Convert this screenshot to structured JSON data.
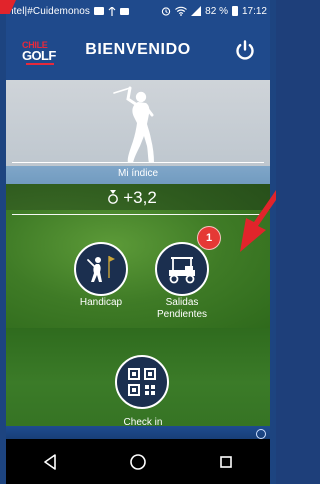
{
  "status_bar": {
    "carrier": "ntel|#Cuidemonos",
    "battery": "82 %",
    "time": "17:12",
    "icons": [
      "messages-icon",
      "network-icon",
      "sim-icon",
      "alarm-icon",
      "wifi-icon",
      "signal-icon",
      "battery-icon"
    ]
  },
  "header": {
    "logo_line1": "CHILE",
    "logo_line2": "GOLF",
    "title": "BIENVENIDO",
    "power_icon": "power-icon"
  },
  "profile": {
    "index_label": "Mi índice",
    "index_value": "+3,2"
  },
  "actions": {
    "handicap_label": "Handicap",
    "salidas_label_line1": "Salidas",
    "salidas_label_line2": "Pendientes",
    "salidas_badge": "1",
    "checkin_label": "Check in"
  },
  "nav": {
    "back_icon": "back-icon",
    "home_icon": "home-icon",
    "recents_icon": "recents-icon"
  },
  "colors": {
    "header_blue": "#1f4a8c",
    "badge_red": "#e53935",
    "annotation_red": "#e1242b",
    "button_dark": "#1b2f4f"
  }
}
